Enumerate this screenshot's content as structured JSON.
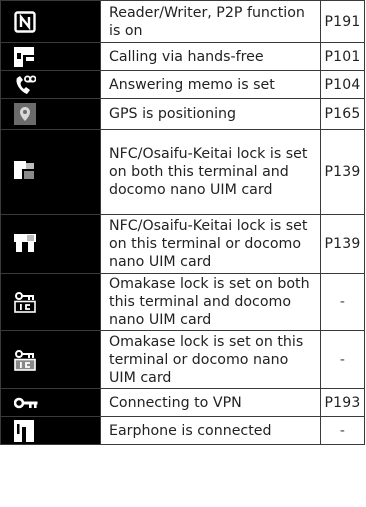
{
  "rows": [
    {
      "icon": "nfc-reader-writer-icon",
      "description": "Reader/Writer, P2P function is on",
      "page": "P191"
    },
    {
      "icon": "hands-free-call-icon",
      "description": "Calling via hands-free",
      "page": "P101"
    },
    {
      "icon": "answering-memo-icon",
      "description": "Answering memo is set",
      "page": "P104"
    },
    {
      "icon": "gps-location-icon",
      "description": "GPS is positioning",
      "page": "P165"
    },
    {
      "icon": "nfc-lock-both-icon",
      "description": "NFC/Osaifu-Keitai lock is set on both this terminal and docomo nano UIM card",
      "page": "P139"
    },
    {
      "icon": "nfc-lock-either-icon",
      "description": "NFC/Osaifu-Keitai lock is set on this terminal or docomo nano UIM card",
      "page": "P139"
    },
    {
      "icon": "omakase-lock-both-icon",
      "description": "Omakase lock is set on both this terminal and docomo nano UIM card",
      "page": "-"
    },
    {
      "icon": "omakase-lock-either-icon",
      "description": "Omakase lock is set on this terminal or docomo nano UIM card",
      "page": "-"
    },
    {
      "icon": "vpn-key-icon",
      "description": "Connecting to VPN",
      "page": "P193"
    },
    {
      "icon": "earphone-icon",
      "description": "Earphone is connected",
      "page": "-"
    }
  ]
}
